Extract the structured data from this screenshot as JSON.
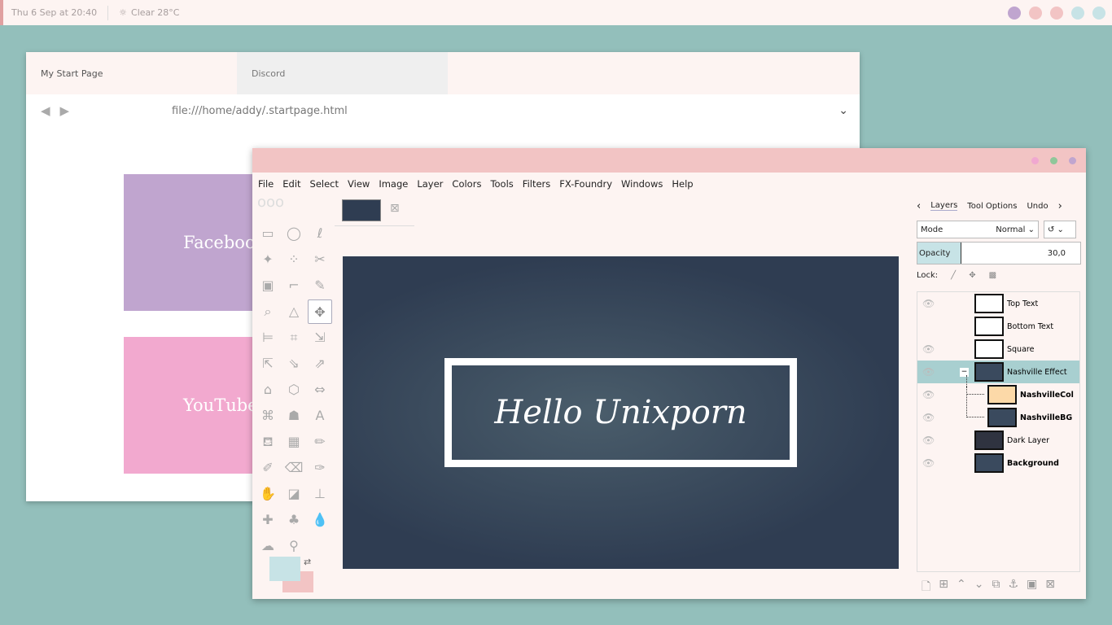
{
  "topbar": {
    "datetime": "Thu 6 Sep at 20:40",
    "weather_icon": "sun-icon",
    "weather": "Clear 28°C",
    "dots": [
      "#c0a5cf",
      "#f2c4c4",
      "#f2c4c4",
      "#c7e3e6",
      "#c7e3e6"
    ]
  },
  "browser": {
    "tabs": [
      {
        "label": "My Start Page"
      },
      {
        "label": "Discord"
      }
    ],
    "url": "file:///home/addy/.startpage.html",
    "tiles": [
      {
        "label": "Facebook",
        "color": "#c0a5cf"
      },
      {
        "label": "YouTube",
        "color": "#f2a9cf"
      }
    ]
  },
  "gimp": {
    "menu": [
      "File",
      "Edit",
      "Select",
      "View",
      "Image",
      "Layer",
      "Colors",
      "Tools",
      "Filters",
      "FX-Foundry",
      "Windows",
      "Help"
    ],
    "canvas_text": "Hello Unixporn",
    "panel": {
      "tabs": [
        "Layers",
        "Tool Options",
        "Undo"
      ],
      "mode_label": "Mode",
      "mode_value": "Normal",
      "opacity_label": "Opacity",
      "opacity_value": "30,0",
      "lock_label": "Lock:"
    },
    "layers": [
      {
        "name": "Top Text",
        "visible": true,
        "bold": false
      },
      {
        "name": "Bottom Text",
        "visible": false,
        "bold": false
      },
      {
        "name": "Square",
        "visible": true,
        "bold": false
      },
      {
        "name": "Nashville Effect",
        "visible": true,
        "bold": false,
        "selected": true,
        "group": true
      },
      {
        "name": "NashvilleCol",
        "visible": true,
        "bold": true,
        "child": true,
        "color": "#fcd9a8"
      },
      {
        "name": "NashvilleBG",
        "visible": true,
        "bold": true,
        "child": true
      },
      {
        "name": "Dark Layer",
        "visible": true,
        "bold": false,
        "color": "#2f3340"
      },
      {
        "name": "Background",
        "visible": true,
        "bold": true
      }
    ],
    "fg_color": "#c7e3e6",
    "bg_color": "#f2c4c4"
  }
}
